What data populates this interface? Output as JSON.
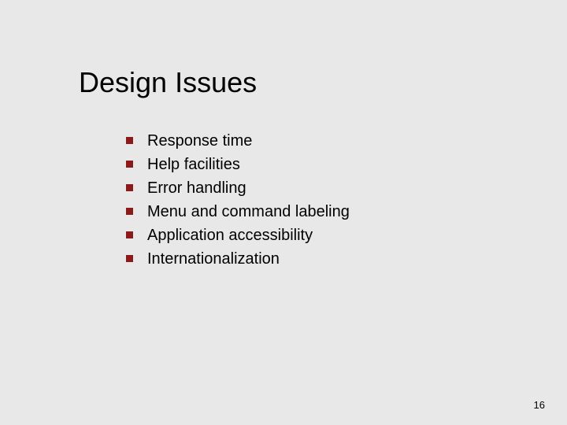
{
  "title": "Design Issues",
  "bullets": [
    "Response time",
    "Help facilities",
    "Error handling",
    "Menu and command labeling",
    "Application accessibility",
    "Internationalization"
  ],
  "page_number": "16",
  "bullet_color": "#8b1a1a"
}
